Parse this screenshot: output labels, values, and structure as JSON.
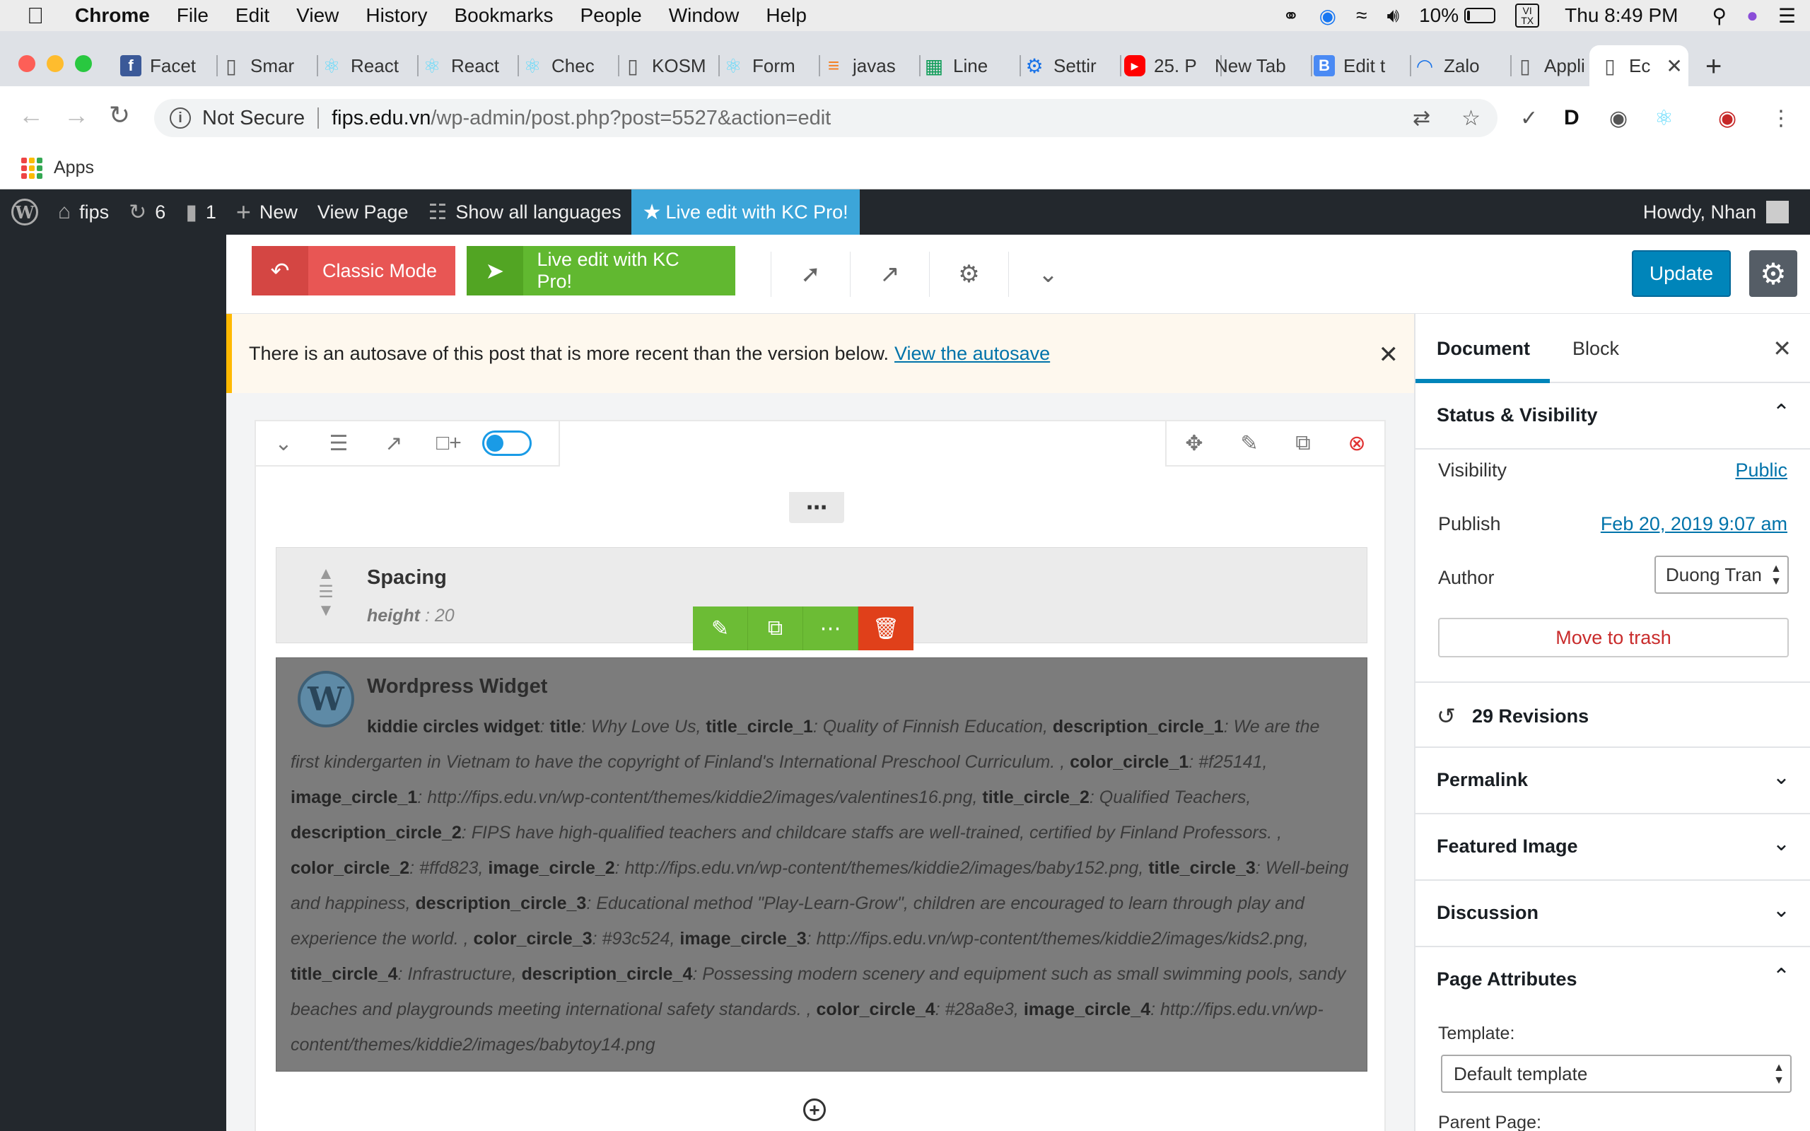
{
  "macos": {
    "menu": [
      "Chrome",
      "File",
      "Edit",
      "View",
      "History",
      "Bookmarks",
      "People",
      "Window",
      "Help"
    ],
    "battery_text": "10%",
    "battery_level": 0.1,
    "clock": "Thu 8:49 PM",
    "input_badge": "VI TX"
  },
  "tabs": [
    {
      "label": "Facet",
      "icon": "facebook-icon",
      "color": "#3b5998",
      "glyph": "f"
    },
    {
      "label": "Smar",
      "icon": "document-icon",
      "color": "",
      "glyph": "▯"
    },
    {
      "label": "React",
      "icon": "react-icon",
      "color": "#61dafb",
      "glyph": "⚛"
    },
    {
      "label": "React",
      "icon": "react-icon",
      "color": "#61dafb",
      "glyph": "⚛"
    },
    {
      "label": "Chec",
      "icon": "react-icon",
      "color": "#61dafb",
      "glyph": "⚛"
    },
    {
      "label": "KOSM",
      "icon": "document-icon",
      "color": "",
      "glyph": "▯"
    },
    {
      "label": "Form",
      "icon": "react-icon",
      "color": "#61dafb",
      "glyph": "⚛"
    },
    {
      "label": "javas",
      "icon": "stackoverflow-icon",
      "color": "#f48024",
      "glyph": "≡"
    },
    {
      "label": "Line",
      "icon": "sheet-icon",
      "color": "#0f9d58",
      "glyph": "▦"
    },
    {
      "label": "Settir",
      "icon": "gear-icon",
      "color": "#1a73e8",
      "glyph": "⚙"
    },
    {
      "label": "25. P",
      "icon": "youtube-icon",
      "color": "#ff0000",
      "glyph": "▶"
    },
    {
      "label": "New Tab",
      "icon": "",
      "color": "",
      "glyph": ""
    },
    {
      "label": "Edit t",
      "icon": "bootstrap-icon",
      "color": "#4a8af4",
      "glyph": "B"
    },
    {
      "label": "Zalo",
      "icon": "loading-icon",
      "color": "#1a73e8",
      "glyph": "◠"
    },
    {
      "label": "Appli",
      "icon": "document-icon",
      "color": "",
      "glyph": "▯"
    },
    {
      "label": "Ec",
      "icon": "document-icon",
      "color": "",
      "glyph": "▯",
      "active": true
    }
  ],
  "omnibox": {
    "security": "Not Secure",
    "host": "fips.edu.vn",
    "path": "/wp-admin/post.php?post=5527&action=edit"
  },
  "bookmarks": {
    "apps": "Apps"
  },
  "adminbar": {
    "site": "fips",
    "updates": "6",
    "comments": "1",
    "new": "New",
    "view_page": "View Page",
    "languages": "Show all languages",
    "kc_live": "Live edit with KC Pro!",
    "howdy": "Howdy, Nhan"
  },
  "editor_header": {
    "classic_mode": "Classic Mode",
    "kc_live": "Live edit with KC Pro!",
    "update": "Update"
  },
  "notice": {
    "text": "There is an autosave of this post that is more recent than the version below.",
    "link": "View the autosave"
  },
  "elements": {
    "spacing": {
      "title": "Spacing",
      "param_key": "height",
      "param_value": " : 20"
    },
    "widget": {
      "title": "Wordpress Widget",
      "segments": [
        {
          "k": "kiddie circles widget",
          "v": ": "
        },
        {
          "k": "title",
          "v": ": Why Love Us, "
        },
        {
          "k": "title_circle_1",
          "v": ": Quality of Finnish Education, "
        },
        {
          "k": "description_circle_1",
          "v": ": We are the first kindergarten in Vietnam to have the copyright of Finland's International Preschool Curriculum. , "
        },
        {
          "k": "color_circle_1",
          "v": ": #f25141, "
        },
        {
          "k": "image_circle_1",
          "v": ": http://fips.edu.vn/wp-content/themes/kiddie2/images/valentines16.png, "
        },
        {
          "k": "title_circle_2",
          "v": ": Qualified Teachers, "
        },
        {
          "k": "description_circle_2",
          "v": ": FIPS have high-qualified teachers and childcare staffs are well-trained, certified by Finland Professors. , "
        },
        {
          "k": "color_circle_2",
          "v": ": #ffd823, "
        },
        {
          "k": "image_circle_2",
          "v": ": http://fips.edu.vn/wp-content/themes/kiddie2/images/baby152.png, "
        },
        {
          "k": "title_circle_3",
          "v": ": Well-being and happiness, "
        },
        {
          "k": "description_circle_3",
          "v": ": Educational method \"Play-Learn-Grow\", children are encouraged to learn through play and experience the world. , "
        },
        {
          "k": "color_circle_3",
          "v": ": #93c524, "
        },
        {
          "k": "image_circle_3",
          "v": ": http://fips.edu.vn/wp-content/themes/kiddie2/images/kids2.png, "
        },
        {
          "k": "title_circle_4",
          "v": ": Infrastructure, "
        },
        {
          "k": "description_circle_4",
          "v": ": Possessing modern scenery and equipment such as small swimming pools, sandy beaches and playgrounds meeting international safety standards. , "
        },
        {
          "k": "color_circle_4",
          "v": ": #28a8e3, "
        },
        {
          "k": "image_circle_4",
          "v": ": http://fips.edu.vn/wp-content/themes/kiddie2/images/babytoy14.png"
        }
      ]
    }
  },
  "sidebar": {
    "tab_document": "Document",
    "tab_block": "Block",
    "status_title": "Status & Visibility",
    "visibility_label": "Visibility",
    "visibility_value": "Public",
    "publish_label": "Publish",
    "publish_value": "Feb 20, 2019 9:07 am",
    "author_label": "Author",
    "author_value": "Duong Tran",
    "trash": "Move to trash",
    "revisions": "29 Revisions",
    "panels": [
      "Permalink",
      "Featured Image",
      "Discussion"
    ],
    "page_attributes": "Page Attributes",
    "template_label": "Template:",
    "template_value": "Default template",
    "parent_label": "Parent Page:"
  },
  "colors": {
    "wp_dark": "#23282d",
    "kc_blue": "#3ca5d9",
    "classic_red": "#e85654",
    "kc_green": "#61b830",
    "update_blue": "#0085ba",
    "notice_yellow": "#ffb900",
    "delete_red": "#e0401a"
  }
}
